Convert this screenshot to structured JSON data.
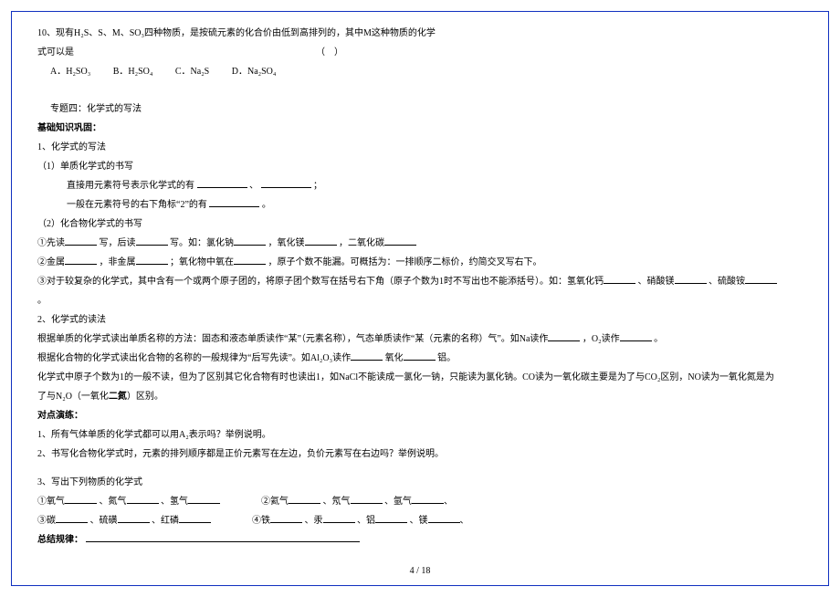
{
  "q10": {
    "line1": "10、现有H₂S、S、M、SO₃四种物质，是按硫元素的化合价由低到高排列的，其中M这种物质的化学",
    "line2": "式可以是",
    "paren": "（　）",
    "optA": "A．H₂SO₃",
    "optB": "B．H₂SO₄",
    "optC": "C．Na₂S",
    "optD": "D．Na₂SO₄"
  },
  "topic4": "专题四：化学式的写法",
  "basics_title": "基础知识巩固：",
  "s1": {
    "h": "1、化学式的写法",
    "p1": "（1）单质化学式的书写",
    "p1a": "直接用元素符号表示化学式的有",
    "p1a_sep": "、",
    "p1a_end": "；",
    "p1b": "一般在元素符号的右下角标“2”的有",
    "p1b_end": "。",
    "p2": "（2）化合物化学式的书写",
    "p2a_pre": "①先读",
    "p2a_mid1": "写，后读",
    "p2a_mid2": "写。如：氯化钠",
    "p2a_mid3": "，氧化镁",
    "p2a_mid4": "，二氧化碳",
    "p2b_pre": "②金属",
    "p2b_mid1": "，非金属",
    "p2b_mid2": "；氧化物中氧在",
    "p2b_tail": "，原子个数不能漏。可概括为：一排顺序二标价，约简交叉写右下。",
    "p2c": "③对于较复杂的化学式，其中含有一个或两个原子团的，将原子团个数写在括号右下角（原子个数为1时不写出也不能添括号）。如：氢氧化钙",
    "p2c_mid1": "、硝酸镁",
    "p2c_mid2": "、硫酸铵",
    "p2c_end": "。"
  },
  "s2": {
    "h": "2、化学式的读法",
    "l1a": "根据单质的化学式读出单质名称的方法：固态和液态单质读作“某”（元素名称），气态单质读作“某（元素的名称）气”。如Na读作",
    "l1b": "，O₂读作",
    "l1c": "。",
    "l2a": "根据化合物的化学式读出化合物的名称的一般规律为“后写先读”。如Al₂O₃读作",
    "l2b": "氧化",
    "l2c": "铝。",
    "l3": "化学式中原子个数为1的一般不读，但为了区别其它化合物有时也读出1，如NaCl不能读成一氯化一钠，只能读为氯化钠。CO读为一氧化碳主要是为了与CO₂区别，NO读为一氧化氮是为",
    "l4a": "了与N₂O（一氧化",
    "l4b": "二氮",
    "l4c": "）区别。"
  },
  "practice_title": "对点演练：",
  "pr1": "1、所有气体单质的化学式都可以用A₂表示吗？举例说明。",
  "pr2": "2、书写化合物化学式时，元素的排列顺序都是正价元素写在左边，负价元素写在右边吗？举例说明。",
  "pr3": {
    "h": "3、写出下列物质的化学式",
    "r1a": "①氧气",
    "r1b": "、氮气",
    "r1c": "、氢气",
    "r1d": "②氦气",
    "r1e": "、氖气",
    "r1f": "、氩气",
    "r2a": "③碳",
    "r2b": "、硫磺",
    "r2c": "、红磷",
    "r2d": "④铁",
    "r2e": "、汞",
    "r2f": "、铝",
    "r2g": "、镁"
  },
  "summary_label": "总结规律：",
  "footer": "4 / 18"
}
